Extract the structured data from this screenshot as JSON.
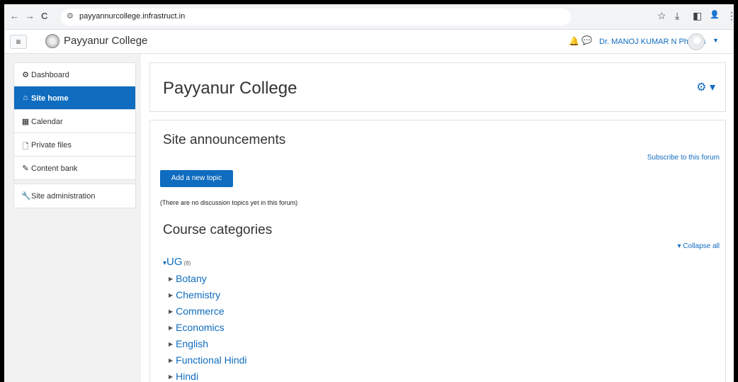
{
  "browser": {
    "url": "payyannurcollege.infrastruct.in",
    "back_icon": "←",
    "forward_icon": "→",
    "reload_icon": "C",
    "site_info_icon": "⚙",
    "star_icon": "☆",
    "download_icon": "⤓",
    "sidepanel_icon": "◧",
    "profile_icon": "👤",
    "menu_icon": "⋮"
  },
  "header": {
    "menu_icon": "≡",
    "site_name": "Payyanur College",
    "notifications_icon": "🔔",
    "messages_icon": "💬",
    "user_name": "Dr. MANOJ KUMAR N Physics",
    "user_caret": "▼"
  },
  "leftnav": {
    "items": [
      {
        "icon": "⚙",
        "label": "Dashboard"
      },
      {
        "icon": "⌂",
        "label": "Site home"
      },
      {
        "icon": "▦",
        "label": "Calendar"
      },
      {
        "icon": "🗋",
        "label": "Private files"
      },
      {
        "icon": "✎",
        "label": "Content bank"
      },
      {
        "icon": "🔧",
        "label": "Site administration"
      }
    ]
  },
  "main": {
    "page_title": "Payyanur College",
    "gear_icon": "⚙ ▾",
    "announcements": {
      "title": "Site announcements",
      "subscribe_link": "Subscribe to this forum",
      "add_topic_button": "Add a new topic",
      "empty_text": "(There are no discussion topics yet in this forum)"
    },
    "categories": {
      "title": "Course categories",
      "collapse_link": "▾ Collapse all",
      "top": {
        "caret": "▾",
        "name": "UG",
        "count": "(8)"
      },
      "children": [
        "Botany",
        "Chemistry",
        "Commerce",
        "Economics",
        "English",
        "Functional Hindi",
        "Hindi"
      ]
    }
  },
  "colors": {
    "brand_blue": "#0f6cbf",
    "page_bg": "#f2f2f2"
  }
}
